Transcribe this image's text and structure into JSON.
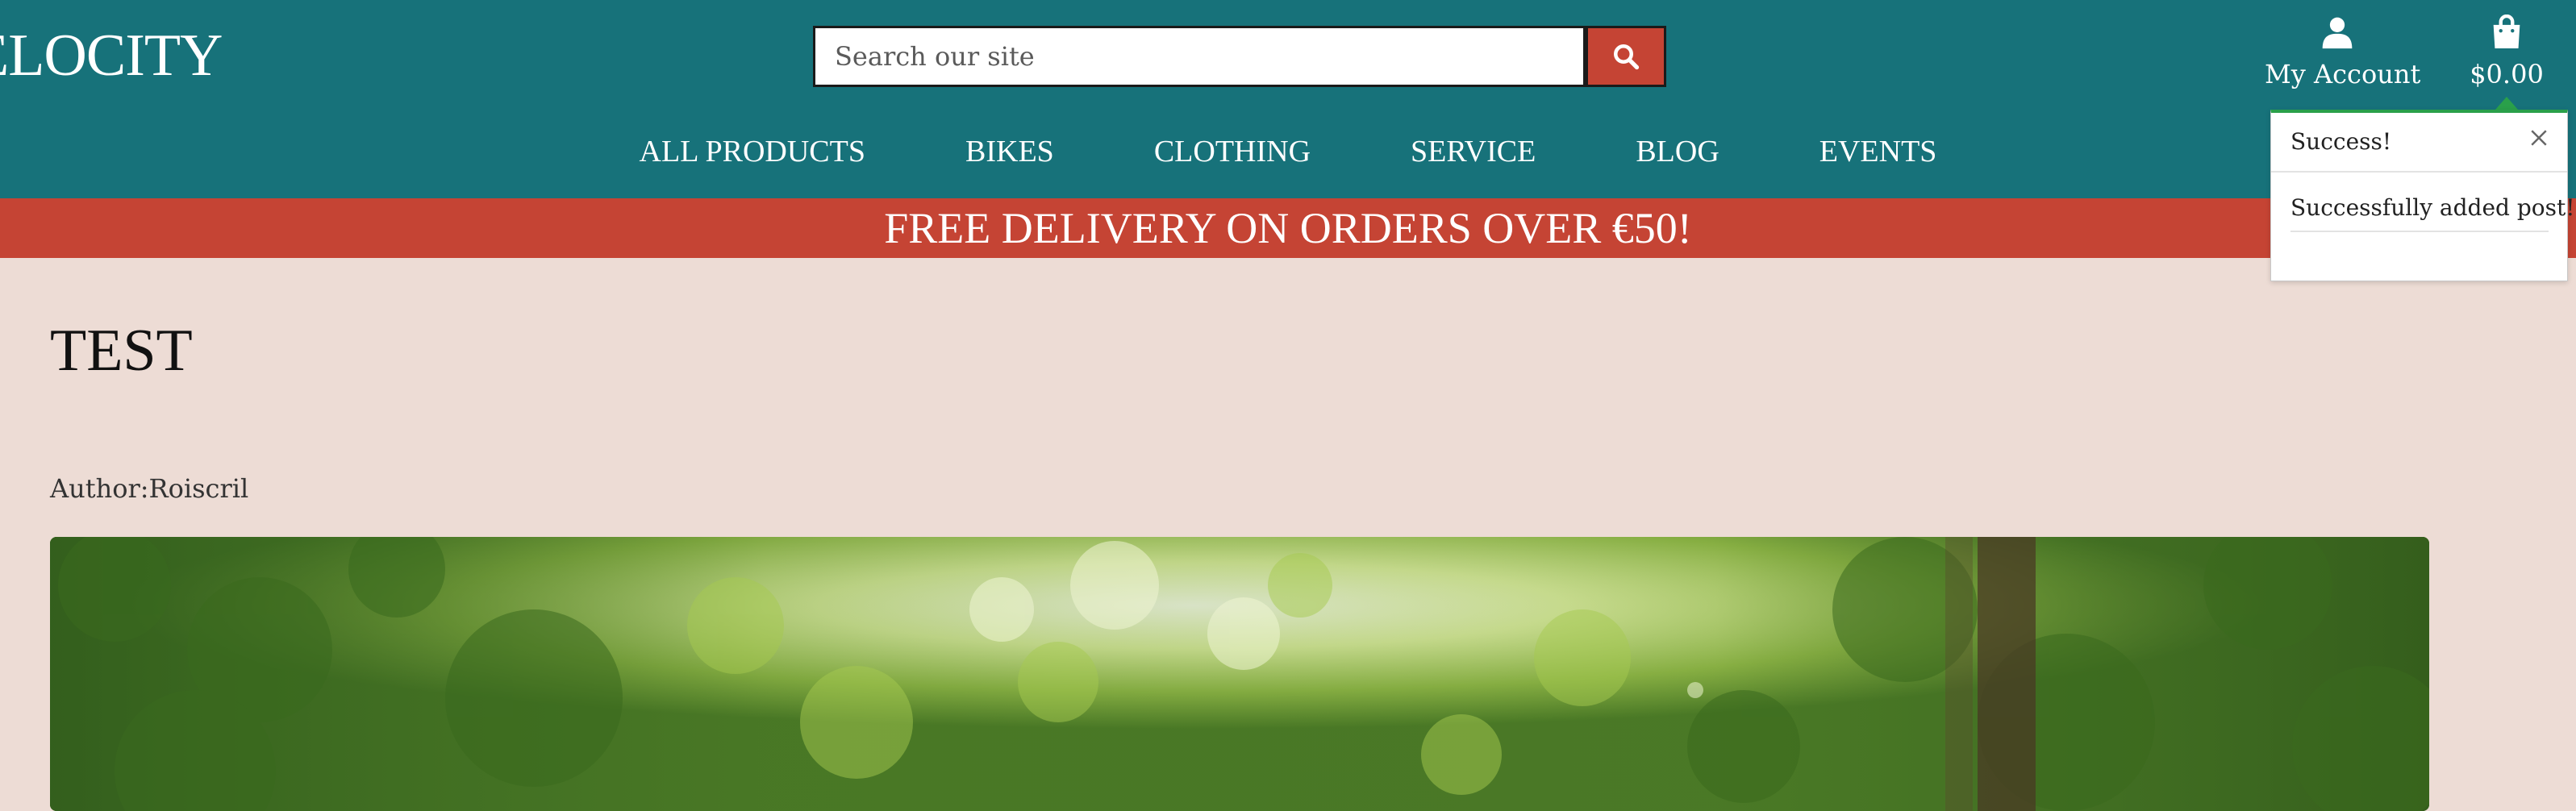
{
  "header": {
    "logo_text": "ELOCITY",
    "search": {
      "placeholder": "Search our site",
      "button_icon": "search-icon"
    },
    "account": {
      "label": "My Account",
      "icon": "user-icon"
    },
    "cart": {
      "total": "$0.00",
      "icon": "shopping-bag-icon"
    }
  },
  "nav": {
    "items": [
      {
        "label": "ALL PRODUCTS"
      },
      {
        "label": "BIKES"
      },
      {
        "label": "CLOTHING"
      },
      {
        "label": "SERVICE"
      },
      {
        "label": "BLOG"
      },
      {
        "label": "EVENTS"
      }
    ]
  },
  "banner": {
    "text": "FREE DELIVERY ON ORDERS OVER €50!"
  },
  "toast": {
    "title": "Success!",
    "message": "Successfully added post!",
    "close_icon": "close-icon"
  },
  "post": {
    "title": "TEST",
    "author": "Author:Roiscril",
    "image_subject": "forest-trail-photo"
  },
  "colors": {
    "header_bg": "#17727a",
    "accent_red": "#c54434",
    "page_bg": "#eddcd5",
    "toast_border": "#2aa04a"
  }
}
